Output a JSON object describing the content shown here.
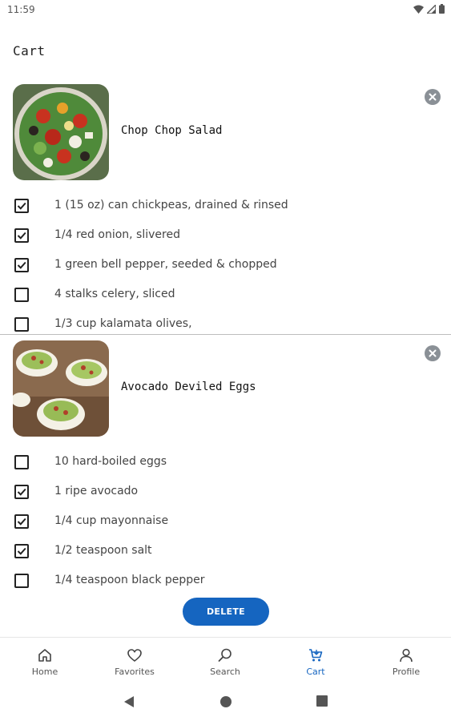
{
  "status_bar": {
    "time": "11:59",
    "icons": [
      "wifi-icon",
      "cell-signal-icon",
      "battery-icon"
    ]
  },
  "page": {
    "title": "Cart"
  },
  "recipes": [
    {
      "name": "Chop Chop Salad",
      "image": "salad-photo",
      "ingredients": [
        {
          "label": "1 (15 oz) can chickpeas, drained & rinsed",
          "checked": true
        },
        {
          "label": "1/4 red onion, slivered",
          "checked": true
        },
        {
          "label": "1 green bell pepper, seeded & chopped",
          "checked": true
        },
        {
          "label": "4 stalks celery, sliced",
          "checked": false
        },
        {
          "label": "1/3 cup kalamata olives,",
          "checked": false
        }
      ]
    },
    {
      "name": "Avocado Deviled Eggs",
      "image": "deviled-eggs-photo",
      "ingredients": [
        {
          "label": "10 hard-boiled eggs",
          "checked": false
        },
        {
          "label": "1 ripe avocado",
          "checked": true
        },
        {
          "label": "1/4 cup mayonnaise",
          "checked": true
        },
        {
          "label": "1/2 teaspoon salt",
          "checked": true
        },
        {
          "label": "1/4 teaspoon black pepper",
          "checked": false
        }
      ]
    }
  ],
  "actions": {
    "delete_label": "DELETE"
  },
  "bottom_nav": {
    "items": [
      {
        "label": "Home",
        "icon": "home-icon",
        "active": false
      },
      {
        "label": "Favorites",
        "icon": "heart-icon",
        "active": false
      },
      {
        "label": "Search",
        "icon": "search-icon",
        "active": false
      },
      {
        "label": "Cart",
        "icon": "cart-icon",
        "active": true
      },
      {
        "label": "Profile",
        "icon": "person-icon",
        "active": false
      }
    ]
  },
  "colors": {
    "accent": "#1565c0",
    "remove_button": "#8a9096",
    "text": "#444444"
  },
  "system_nav": [
    "back-icon",
    "home-circle-icon",
    "recents-icon"
  ]
}
